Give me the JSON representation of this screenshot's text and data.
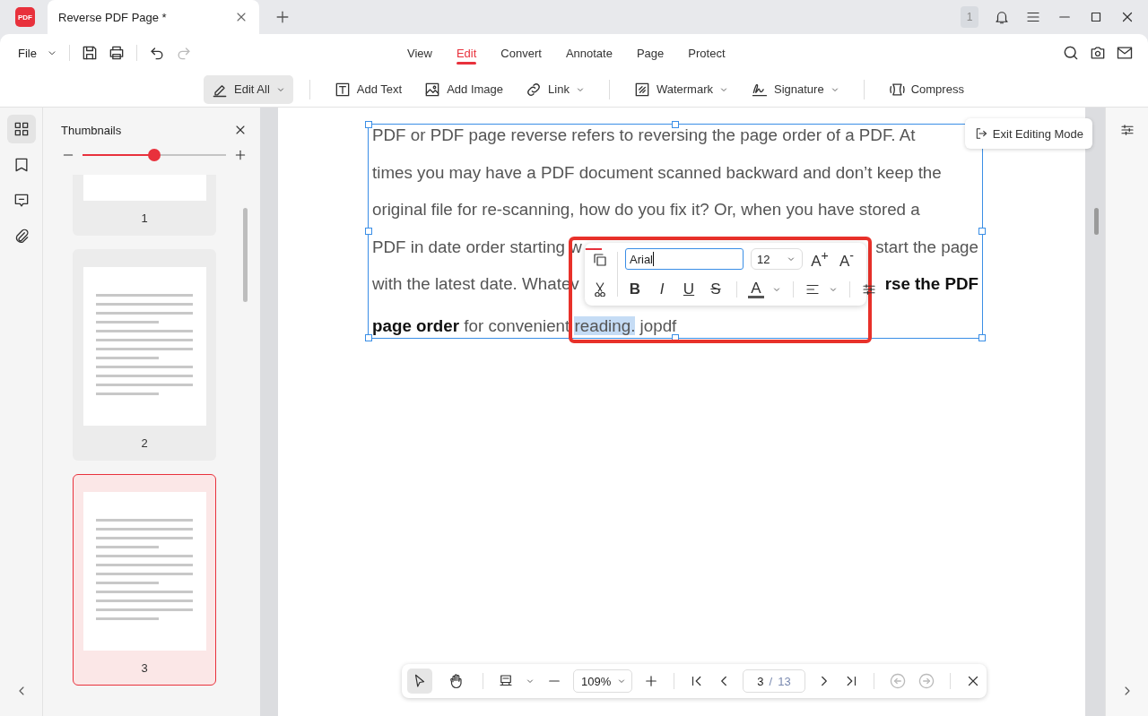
{
  "titlebar": {
    "logo_text": "PDF",
    "tab_title": "Reverse PDF Page *",
    "notification_count": "1"
  },
  "menu": {
    "file": "File",
    "tabs": [
      {
        "label": "View",
        "selected": false
      },
      {
        "label": "Edit",
        "selected": true
      },
      {
        "label": "Convert",
        "selected": false
      },
      {
        "label": "Annotate",
        "selected": false
      },
      {
        "label": "Page",
        "selected": false
      },
      {
        "label": "Protect",
        "selected": false
      }
    ]
  },
  "toolbar": [
    {
      "kind": "button",
      "label": "Edit All",
      "dropdown": true,
      "selected": true
    },
    {
      "kind": "separator"
    },
    {
      "kind": "button",
      "label": "Add Text",
      "dropdown": false,
      "selected": false
    },
    {
      "kind": "button",
      "label": "Add Image",
      "dropdown": false,
      "selected": false
    },
    {
      "kind": "button",
      "label": "Link",
      "dropdown": true,
      "selected": false
    },
    {
      "kind": "separator"
    },
    {
      "kind": "button",
      "label": "Watermark",
      "dropdown": true,
      "selected": false
    },
    {
      "kind": "button",
      "label": "Signature",
      "dropdown": true,
      "selected": false
    },
    {
      "kind": "separator"
    },
    {
      "kind": "button",
      "label": "Compress",
      "dropdown": false,
      "selected": false
    }
  ],
  "sidebar": [
    {
      "selected": true
    },
    {
      "selected": false
    },
    {
      "selected": false
    },
    {
      "selected": false
    }
  ],
  "thumbnails": {
    "title": "Thumbnails",
    "zoom": {
      "level": 0.5
    },
    "pages": [
      {
        "label": "1",
        "selected": false
      },
      {
        "label": "2",
        "selected": false
      },
      {
        "label": "3",
        "selected": true
      }
    ]
  },
  "document": {
    "exit_button": "Exit Editing Mode",
    "lines": [
      {
        "left": [
          {
            "text": "PDF or PDF page reverse refers to reversing the page order of a PDF. At",
            "bold": false,
            "selected": false
          }
        ]
      },
      {
        "left": [
          {
            "text": "times you may have a PDF document scanned backward and don’t keep the",
            "bold": false,
            "selected": false
          }
        ]
      },
      {
        "left": [
          {
            "text": "original file for re-scanning, how do you fix it? Or, when you have stored a",
            "bold": false,
            "selected": false
          }
        ]
      },
      {
        "left": [
          {
            "text": "PDF in date order starting w",
            "bold": false,
            "selected": false
          }
        ],
        "right": [
          {
            "text": "start the page",
            "bold": false,
            "selected": false
          }
        ]
      },
      {
        "left": [
          {
            "text": "with the latest date. Whatev",
            "bold": false,
            "selected": false
          }
        ],
        "right": [
          {
            "text": "rse the PDF",
            "bold": true,
            "selected": false
          }
        ]
      },
      {
        "left": [
          {
            "text": "page order",
            "bold": true,
            "selected": false
          },
          {
            "text": " for convenient ",
            "bold": false,
            "selected": false
          },
          {
            "text": "reading.",
            "bold": false,
            "selected": true
          },
          {
            "text": " jopdf",
            "bold": false,
            "selected": false
          }
        ]
      }
    ]
  },
  "format_toolbar": {
    "font": "Arial",
    "size": "12",
    "grow": "A$^{+}$",
    "shrink": "A$^{-}$",
    "styles": [
      {
        "label": "B",
        "kind": "bold"
      },
      {
        "label": "I",
        "kind": "italic"
      },
      {
        "label": "U",
        "kind": "underline"
      },
      {
        "label": "S",
        "kind": "strike"
      }
    ],
    "color_label": "A"
  },
  "bottom_bar": {
    "tools": [
      {
        "selected": true
      },
      {
        "selected": false
      }
    ],
    "zoom": "109%",
    "page": "3",
    "page_separator": "/",
    "page_total": "13",
    "history": [
      {
        "disabled": true
      },
      {
        "disabled": true
      }
    ]
  }
}
